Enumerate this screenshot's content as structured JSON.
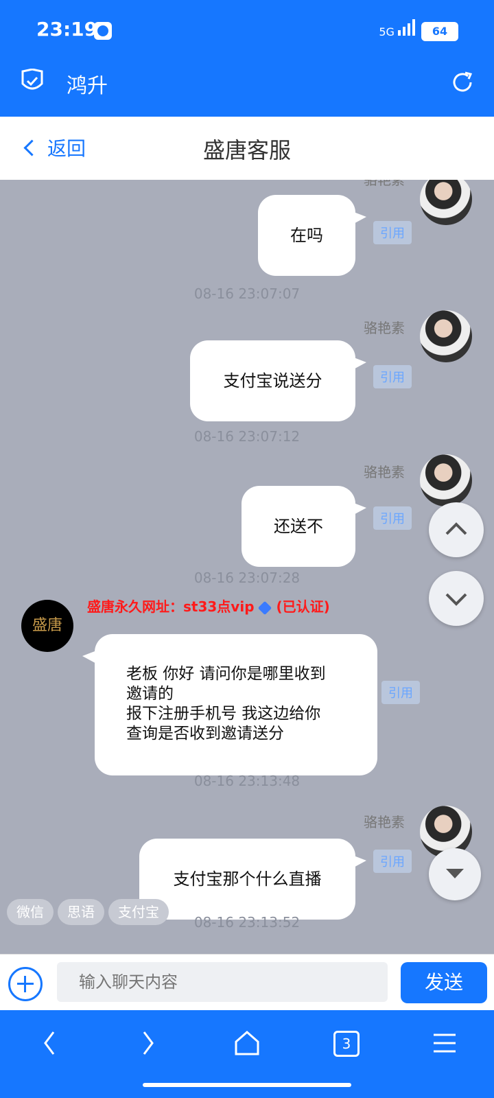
{
  "status": {
    "time": "23:19",
    "network": "5G",
    "battery": "64"
  },
  "browser": {
    "title": "鸿升"
  },
  "nav": {
    "back_label": "返回",
    "title": "盛唐客服"
  },
  "messages": [
    {
      "id": "m1",
      "sender": "骆艳素",
      "text": "在吗",
      "quote": "引用",
      "time": "08-16 23:07:07"
    },
    {
      "id": "m2",
      "sender": "骆艳素",
      "text": "支付宝说送分",
      "quote": "引用",
      "time": "08-16 23:07:12"
    },
    {
      "id": "m3",
      "sender": "骆艳素",
      "text": "还送不",
      "quote": "引用",
      "time": "08-16 23:07:28"
    },
    {
      "id": "m4",
      "sender": "盛唐永久网址：st33点vip",
      "badge": "(已认证)",
      "text_lines": [
        "老板 你好 请问你是哪里收到",
        "邀请的",
        "报下注册手机号 我这边给你",
        "查询是否收到邀请送分"
      ],
      "quote": "引用",
      "time": "08-16 23:13:48"
    },
    {
      "id": "m5",
      "sender": "骆艳素",
      "text": "支付宝那个什么直播",
      "quote": "引用",
      "time": "08-16 23:13:52"
    }
  ],
  "quick_replies": [
    "微信",
    "思语",
    "支付宝"
  ],
  "composer": {
    "placeholder": "输入聊天内容",
    "send_label": "发送"
  },
  "bottom_nav": {
    "tabs_count": "3"
  },
  "colors": {
    "brand": "#1677ff",
    "chat_bg": "#a9adba",
    "alert_red": "#ff1a1a"
  }
}
